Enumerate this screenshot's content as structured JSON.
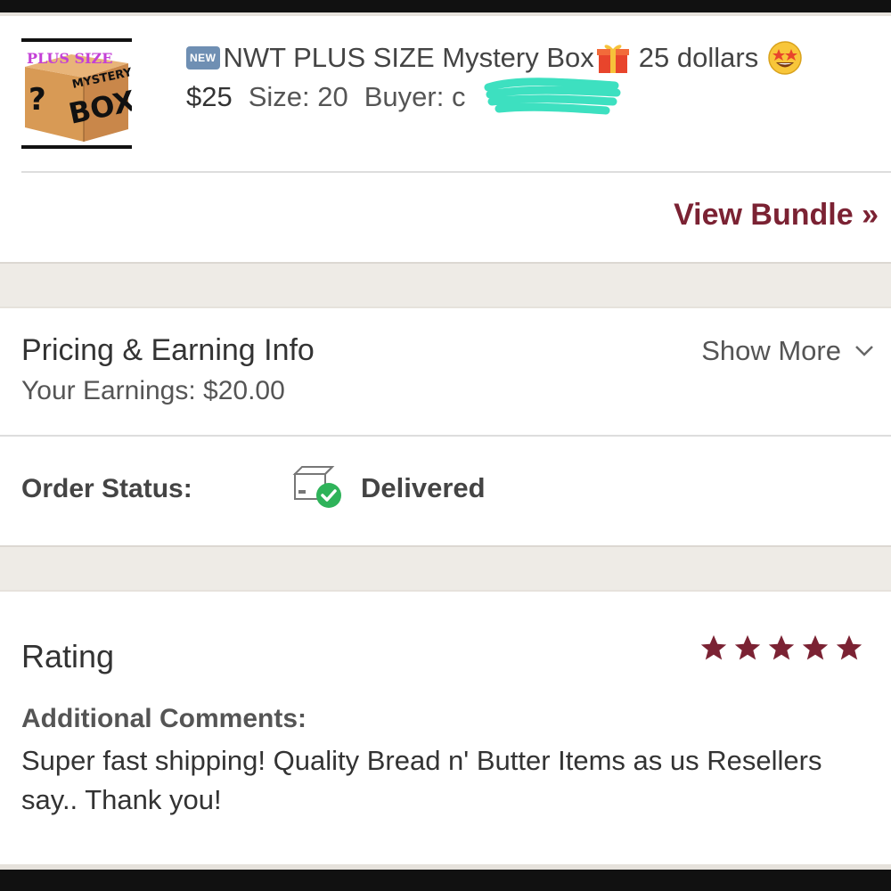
{
  "listing": {
    "thumbnail": {
      "line1": "PLUS SIZE",
      "line2": "MYSTERY",
      "line3": "BOX",
      "mark": "?"
    },
    "badge": "NEW",
    "title": "NWT PLUS SIZE Mystery Box",
    "title_suffix": "25 dollars",
    "price": "$25",
    "size": "Size: 20",
    "buyer_label": "Buyer: c",
    "icons": [
      "new-badge-icon",
      "gift-icon",
      "star-struck-emoji-icon"
    ]
  },
  "bundle": {
    "label": "View Bundle »"
  },
  "pricing": {
    "title": "Pricing & Earning Info",
    "earnings": "Your Earnings: $20.00",
    "show_more": "Show More"
  },
  "order": {
    "label": "Order Status:",
    "status": "Delivered",
    "status_icon": "delivered-box-check-icon"
  },
  "rating": {
    "title": "Rating",
    "stars": 5,
    "max_stars": 5,
    "star_color": "#7b2233",
    "comments_label": "Additional Comments:",
    "comments": "Super fast shipping! Quality Bread n' Butter Items as us Resellers say.. Thank you!"
  },
  "colors": {
    "accent": "#7b2233",
    "band": "#eeebe6",
    "check_green": "#2fb35a",
    "redaction": "#3de0c0"
  }
}
